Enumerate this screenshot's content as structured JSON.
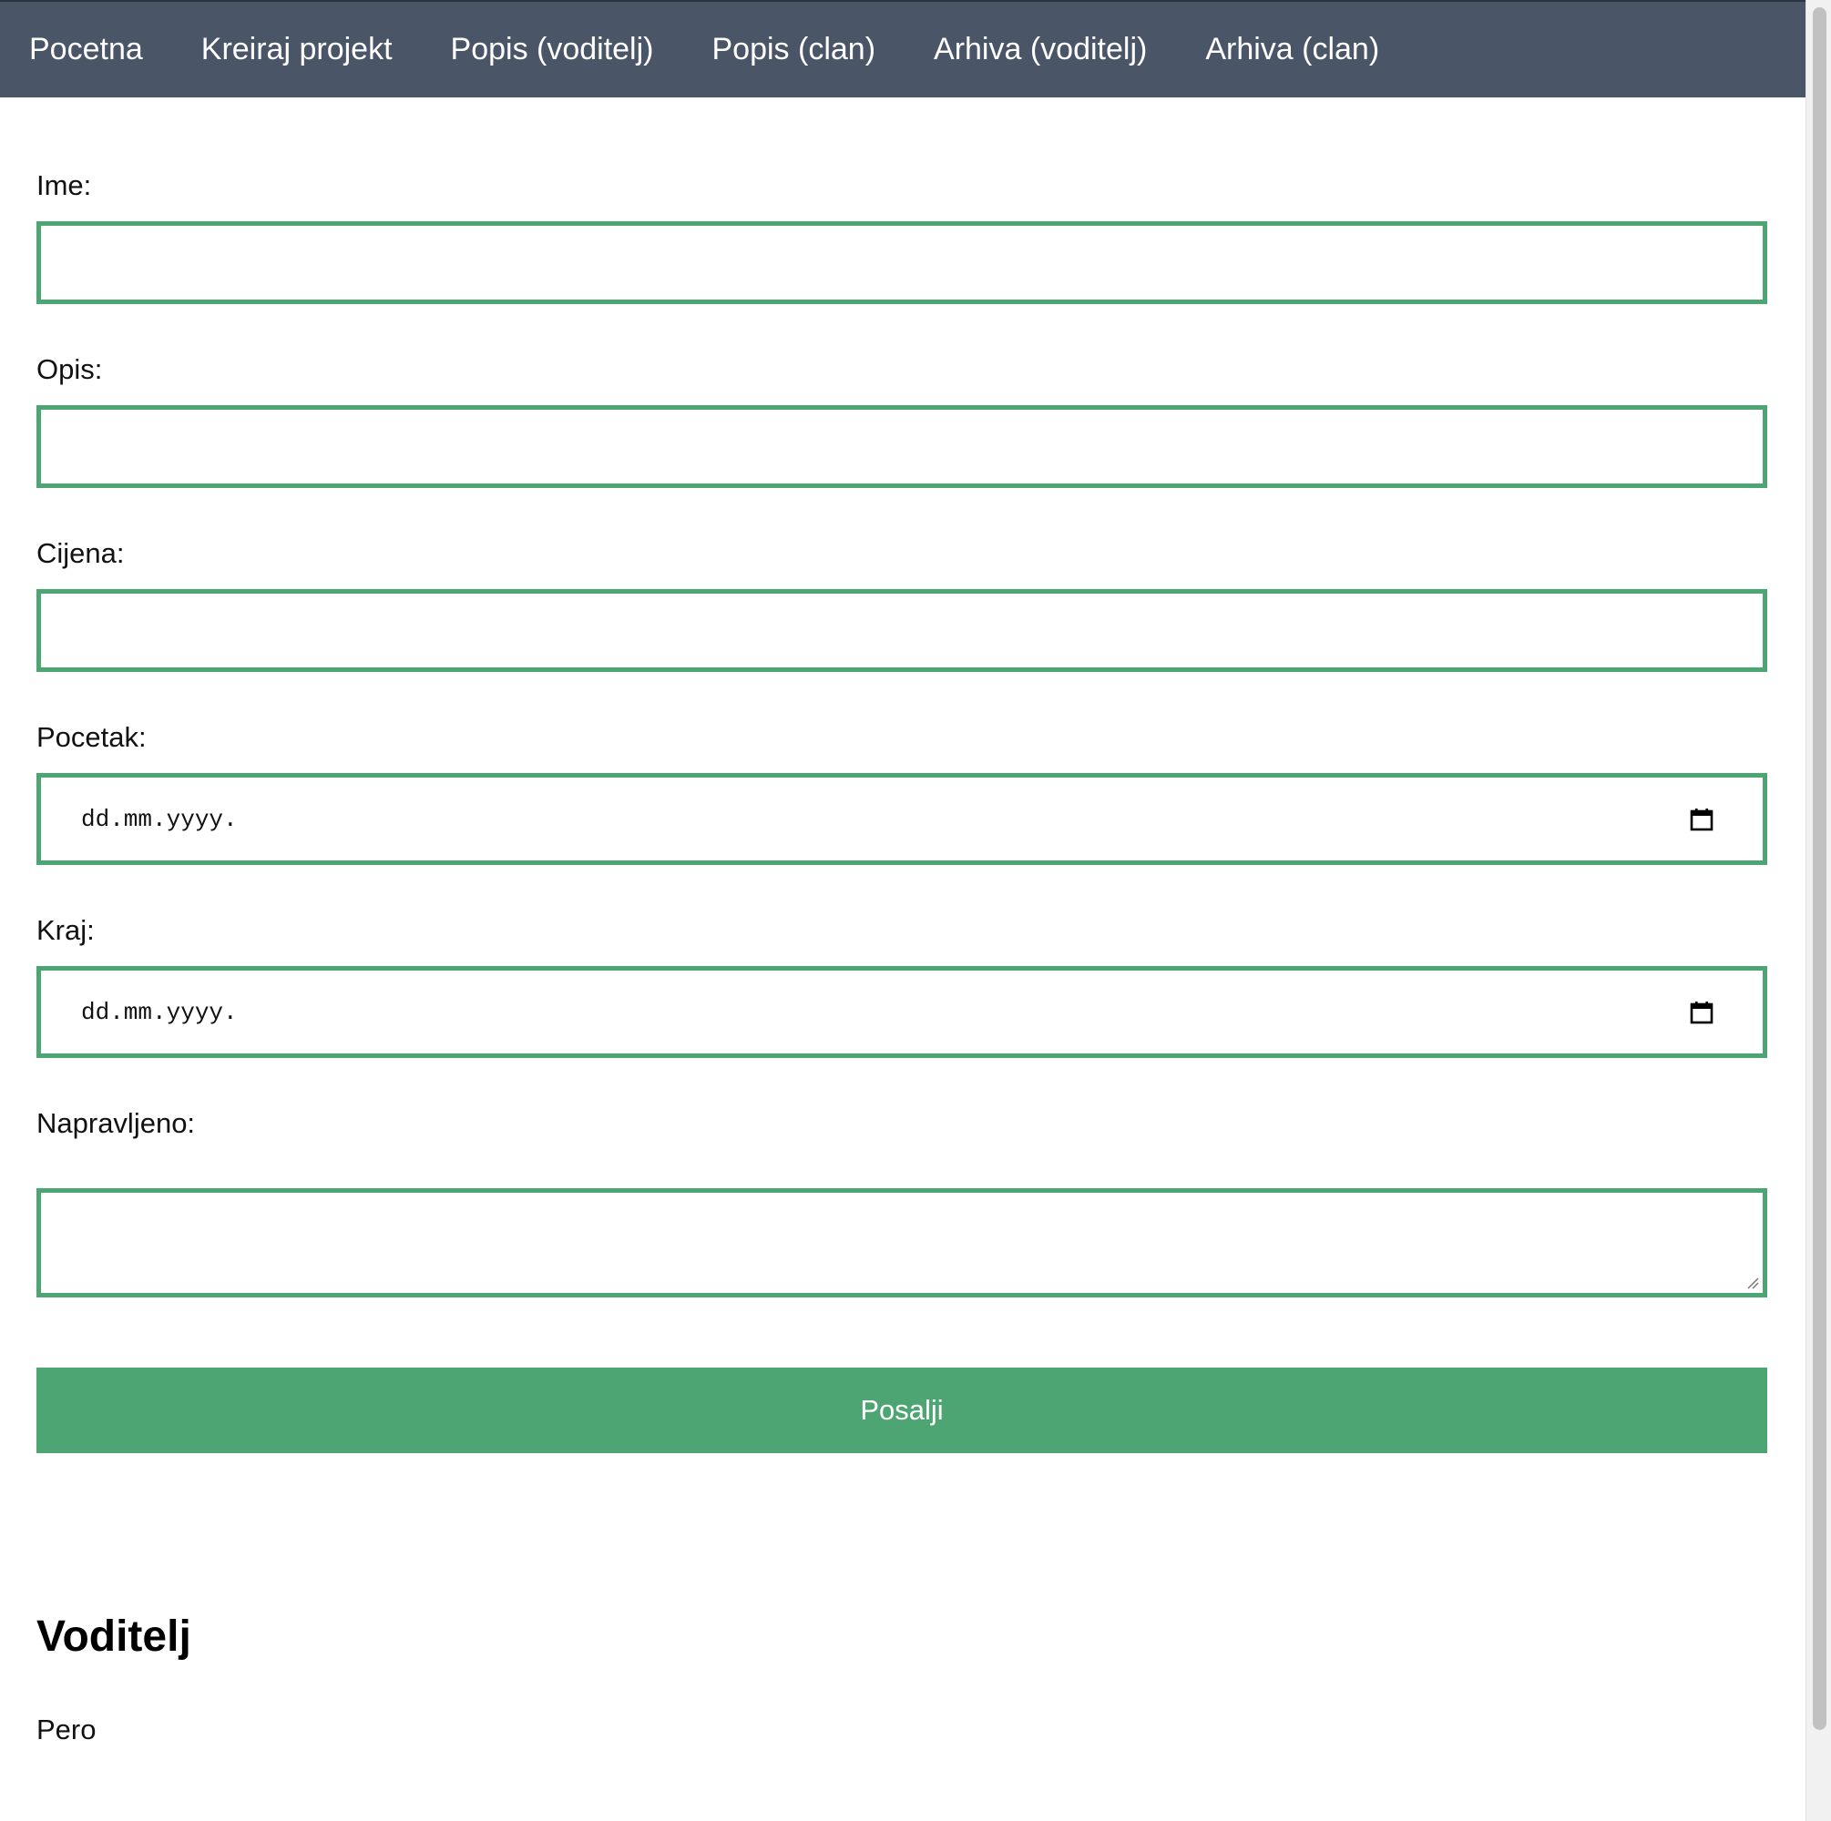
{
  "nav": {
    "items": [
      {
        "label": "Pocetna"
      },
      {
        "label": "Kreiraj projekt"
      },
      {
        "label": "Popis (voditelj)"
      },
      {
        "label": "Popis (clan)"
      },
      {
        "label": "Arhiva (voditelj)"
      },
      {
        "label": "Arhiva (clan)"
      }
    ]
  },
  "form": {
    "name_label": "Ime:",
    "name_value": "",
    "description_label": "Opis:",
    "description_value": "",
    "price_label": "Cijena:",
    "price_value": "",
    "start_label": "Pocetak:",
    "start_placeholder": "dd.mm.yyyy.",
    "end_label": "Kraj:",
    "end_placeholder": "dd.mm.yyyy.",
    "done_label": "Napravljeno:",
    "done_value": "",
    "submit_label": "Posalji"
  },
  "leader": {
    "heading": "Voditelj",
    "name": "Pero"
  },
  "colors": {
    "nav_background": "#4a5568",
    "accent": "#4ea574"
  }
}
